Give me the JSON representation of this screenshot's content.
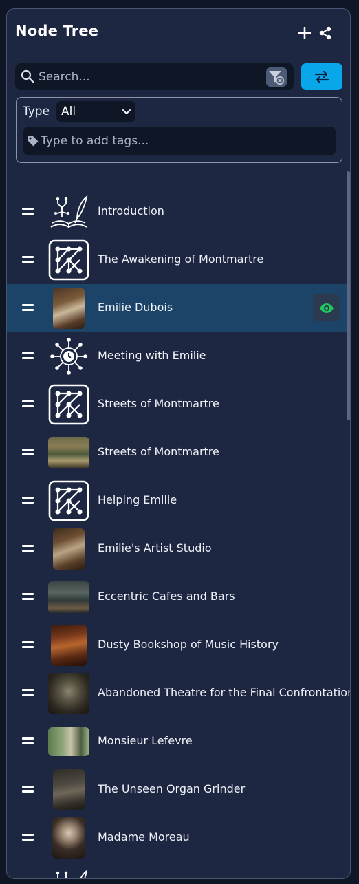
{
  "header": {
    "title": "Node Tree",
    "add_icon": "plus-icon",
    "share_icon": "share-nodes-icon"
  },
  "search": {
    "placeholder": "Search...",
    "value": "",
    "search_icon": "magnifier-icon",
    "clear_icon": "filter-clear-icon"
  },
  "swap_button": {
    "icon": "swap-arrows-icon"
  },
  "filters": {
    "type_label": "Type",
    "type_value": "All",
    "tags_placeholder": "Type to add tags...",
    "tag_icon": "tag-icon"
  },
  "nodes": [
    {
      "label": "Introduction",
      "icon": "book-quill-icon"
    },
    {
      "label": "The Awakening of Montmartre",
      "icon": "graph-network-icon"
    },
    {
      "label": "Emilie Dubois",
      "icon": "portrait-painting-image",
      "selected": true,
      "visibility_icon": "eye-icon"
    },
    {
      "label": "Meeting with Emilie",
      "icon": "clock-network-icon"
    },
    {
      "label": "Streets of Montmartre",
      "icon": "graph-network-icon"
    },
    {
      "label": "Streets of Montmartre",
      "icon": "street-painting-image"
    },
    {
      "label": "Helping Emilie",
      "icon": "graph-network-icon"
    },
    {
      "label": "Emilie's Artist Studio",
      "icon": "studio-painting-image"
    },
    {
      "label": "Eccentric Cafes and Bars",
      "icon": "cafe-painting-image"
    },
    {
      "label": "Dusty Bookshop of Music History",
      "icon": "bookshop-painting-image"
    },
    {
      "label": "Abandoned Theatre for the Final Confrontation",
      "icon": "theatre-painting-image"
    },
    {
      "label": "Monsieur Lefevre",
      "icon": "gentleman-painting-image"
    },
    {
      "label": "The Unseen Organ Grinder",
      "icon": "organ-grinder-painting-image"
    },
    {
      "label": "Madame Moreau",
      "icon": "madame-painting-image"
    }
  ],
  "colors": {
    "panel_bg": "#1e2742",
    "accent": "#0aa6ea",
    "selected_row": "#1c4468",
    "eye_green": "#22c55e"
  }
}
